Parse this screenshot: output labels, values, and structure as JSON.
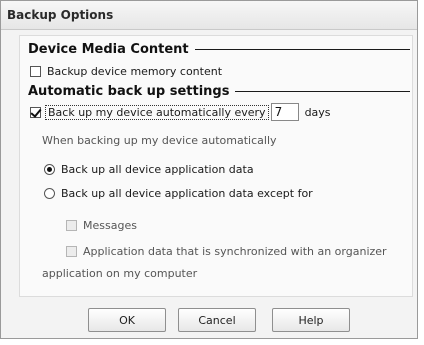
{
  "dialog": {
    "title": "Backup Options"
  },
  "device_media": {
    "heading": "Device Media Content",
    "backup_memory": {
      "label": "Backup device memory content",
      "checked": false
    }
  },
  "auto_backup": {
    "heading": "Automatic back up settings",
    "enable": {
      "label": "Back up my device automatically every",
      "checked": true
    },
    "days_value": "7",
    "days_label": "days",
    "when_label": "When backing up my device automatically",
    "option_all": {
      "label": "Back up all device application data",
      "selected": true
    },
    "option_except": {
      "label": "Back up all device application data except for",
      "selected": false
    },
    "messages": {
      "label": "Messages",
      "checked": false,
      "enabled": false
    },
    "organizer_line1": "Application data that is synchronized with an organizer",
    "organizer_line2": "application on my computer"
  },
  "buttons": {
    "ok": "OK",
    "cancel": "Cancel",
    "help": "Help"
  }
}
